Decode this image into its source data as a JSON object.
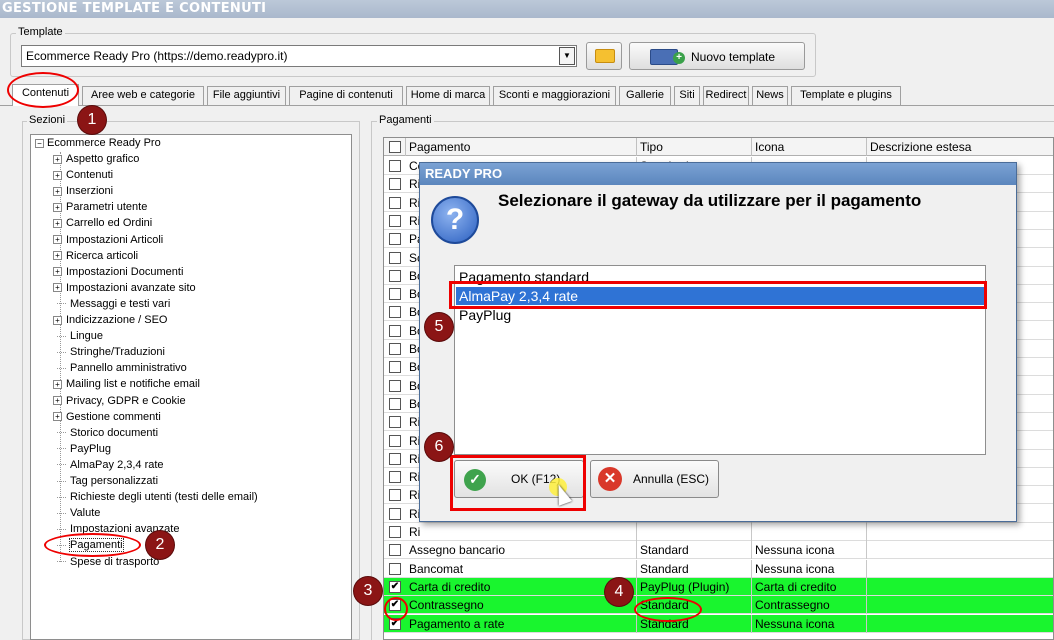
{
  "window": {
    "title": "GESTIONE TEMPLATE E CONTENUTI"
  },
  "template_group": {
    "caption": "Template",
    "selected": "Ecommerce Ready Pro (https://demo.readypro.it)",
    "new_button": "Nuovo template"
  },
  "tabs": [
    "Contenuti",
    "Aree web e categorie",
    "File aggiuntivi",
    "Pagine di contenuti",
    "Home di marca",
    "Sconti e maggiorazioni",
    "Gallerie",
    "Siti",
    "Redirect",
    "News",
    "Template e plugins"
  ],
  "sections": {
    "caption": "Sezioni",
    "root": "Ecommerce Ready Pro",
    "items": [
      {
        "label": "Aspetto grafico",
        "expandable": true
      },
      {
        "label": "Contenuti",
        "expandable": true
      },
      {
        "label": "Inserzioni",
        "expandable": true
      },
      {
        "label": "Parametri utente",
        "expandable": true
      },
      {
        "label": "Carrello ed Ordini",
        "expandable": true
      },
      {
        "label": "Impostazioni Articoli",
        "expandable": true
      },
      {
        "label": "Ricerca articoli",
        "expandable": true
      },
      {
        "label": "Impostazioni Documenti",
        "expandable": true
      },
      {
        "label": "Impostazioni avanzate sito",
        "expandable": true
      },
      {
        "label": "Messaggi e testi vari",
        "expandable": false
      },
      {
        "label": "Indicizzazione / SEO",
        "expandable": true
      },
      {
        "label": "Lingue",
        "expandable": false
      },
      {
        "label": "Stringhe/Traduzioni",
        "expandable": false
      },
      {
        "label": "Pannello amministrativo",
        "expandable": false
      },
      {
        "label": "Mailing list e notifiche email",
        "expandable": true
      },
      {
        "label": "Privacy, GDPR e Cookie",
        "expandable": true
      },
      {
        "label": "Gestione commenti",
        "expandable": true
      },
      {
        "label": "Storico documenti",
        "expandable": false
      },
      {
        "label": "PayPlug",
        "expandable": false
      },
      {
        "label": "AlmaPay 2,3,4 rate",
        "expandable": false
      },
      {
        "label": "Tag personalizzati",
        "expandable": false
      },
      {
        "label": "Richieste degli utenti (testi delle email)",
        "expandable": false
      },
      {
        "label": "Valute",
        "expandable": false
      },
      {
        "label": "Impostazioni avanzate",
        "expandable": false
      },
      {
        "label": "Pagamenti",
        "expandable": false,
        "selected": true
      },
      {
        "label": "Spese di trasporto",
        "expandable": false
      }
    ]
  },
  "payments": {
    "caption": "Pagamenti",
    "columns": [
      "Pagamento",
      "Tipo",
      "Icona",
      "Descrizione estesa"
    ],
    "rows": [
      {
        "name": "Co",
        "type": "Standard",
        "icon": "",
        "checked": false,
        "green": false
      },
      {
        "name": "Ri",
        "type": "",
        "icon": "",
        "checked": false,
        "green": false
      },
      {
        "name": "Ri",
        "type": "",
        "icon": "",
        "checked": false,
        "green": false
      },
      {
        "name": "Ri",
        "type": "",
        "icon": "",
        "checked": false,
        "green": false
      },
      {
        "name": "Pa",
        "type": "",
        "icon": "",
        "checked": false,
        "green": false
      },
      {
        "name": "Sc",
        "type": "",
        "icon": "",
        "checked": false,
        "green": false
      },
      {
        "name": "Bo",
        "type": "",
        "icon": "",
        "checked": false,
        "green": false
      },
      {
        "name": "Bo",
        "type": "",
        "icon": "",
        "checked": false,
        "green": false
      },
      {
        "name": "Bo",
        "type": "",
        "icon": "",
        "checked": false,
        "green": false
      },
      {
        "name": "Bo",
        "type": "",
        "icon": "",
        "checked": false,
        "green": false
      },
      {
        "name": "Bo",
        "type": "",
        "icon": "",
        "checked": false,
        "green": false
      },
      {
        "name": "Bo",
        "type": "",
        "icon": "",
        "checked": false,
        "green": false
      },
      {
        "name": "Bo",
        "type": "",
        "icon": "",
        "checked": false,
        "green": false
      },
      {
        "name": "Bo",
        "type": "",
        "icon": "",
        "checked": false,
        "green": false
      },
      {
        "name": "Ri",
        "type": "",
        "icon": "",
        "checked": false,
        "green": false
      },
      {
        "name": "Ri",
        "type": "",
        "icon": "",
        "checked": false,
        "green": false
      },
      {
        "name": "Ri",
        "type": "",
        "icon": "",
        "checked": false,
        "green": false
      },
      {
        "name": "Ri",
        "type": "",
        "icon": "",
        "checked": false,
        "green": false
      },
      {
        "name": "Ri",
        "type": "",
        "icon": "",
        "checked": false,
        "green": false
      },
      {
        "name": "Ri",
        "type": "",
        "icon": "",
        "checked": false,
        "green": false
      },
      {
        "name": "Ri",
        "type": "",
        "icon": "",
        "checked": false,
        "green": false
      },
      {
        "name": "Assegno bancario",
        "type": "Standard",
        "icon": "Nessuna icona",
        "checked": false,
        "green": false
      },
      {
        "name": "Bancomat",
        "type": "Standard",
        "icon": "Nessuna icona",
        "checked": false,
        "green": false
      },
      {
        "name": "Carta di credito",
        "type": "PayPlug (Plugin)",
        "icon": "Carta di credito",
        "checked": true,
        "green": true
      },
      {
        "name": "Contrassegno",
        "type": "Standard",
        "icon": "Contrassegno",
        "checked": true,
        "green": true
      },
      {
        "name": "Pagamento a rate",
        "type": "Standard",
        "icon": "Nessuna icona",
        "checked": true,
        "green": true
      }
    ]
  },
  "dialog": {
    "title": "READY PRO",
    "message": "Selezionare il gateway da utilizzare per il pagamento",
    "options": [
      "Pagamento standard",
      "AlmaPay 2,3,4 rate",
      "PayPlug"
    ],
    "selected_index": 1,
    "ok_label": "OK (F12)",
    "cancel_label": "Annulla (ESC)"
  },
  "markers": [
    "1",
    "2",
    "3",
    "4",
    "5",
    "6"
  ],
  "colors": {
    "highlight_row": "#19f52e",
    "selection": "#2f73d5",
    "annotation": "#e00000",
    "marker": "#8b1515"
  }
}
